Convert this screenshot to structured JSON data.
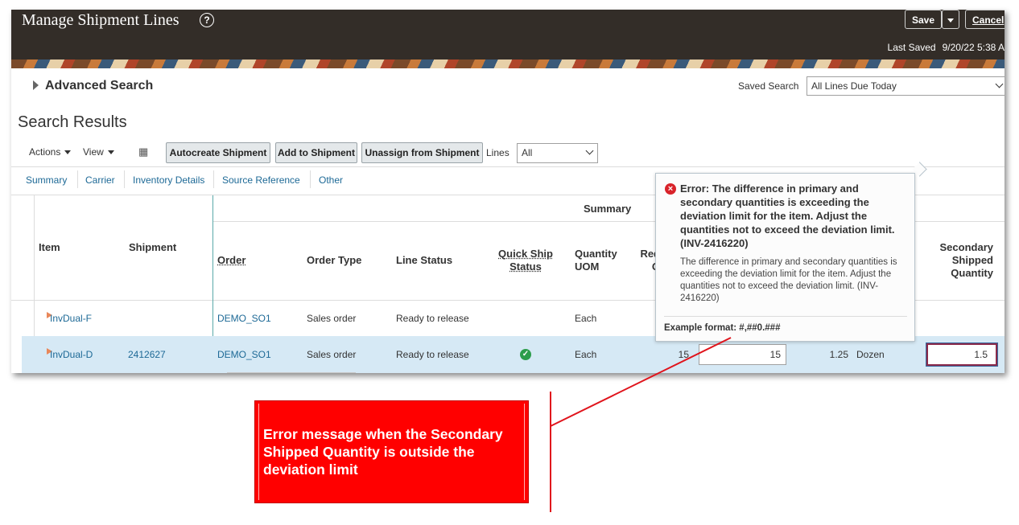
{
  "header": {
    "title": "Manage Shipment Lines",
    "save_label": "Save",
    "cancel_label": "Cancel",
    "last_saved_label": "Last Saved",
    "last_saved_value": "9/20/22 5:38 A"
  },
  "search": {
    "advanced_search_label": "Advanced Search",
    "saved_search_label": "Saved Search",
    "saved_search_value": "All Lines Due Today"
  },
  "results": {
    "title": "Search Results",
    "actions_label": "Actions",
    "view_label": "View",
    "autocreate_label": "Autocreate Shipment",
    "add_label": "Add to Shipment",
    "unassign_label": "Unassign from Shipment",
    "lines_label": "Lines",
    "lines_value": "All"
  },
  "tabs": [
    "Summary",
    "Carrier",
    "Inventory Details",
    "Source Reference",
    "Other"
  ],
  "table": {
    "group_header": "Summary",
    "columns": {
      "item": "Item",
      "shipment": "Shipment",
      "order": "Order",
      "order_type": "Order Type",
      "line_status": "Line Status",
      "quick_ship_1": "Quick Ship",
      "quick_ship_2": "Status",
      "uom_1": "Quantity",
      "uom_2": "UOM",
      "req_1": "Req",
      "req_2": "Q",
      "sec_1": "Secondary",
      "sec_2": "Shipped",
      "sec_3": "Quantity"
    },
    "rows": [
      {
        "item": "InvDual-F",
        "shipment": "",
        "order": "DEMO_SO1",
        "order_type": "Sales order",
        "line_status": "Ready to release",
        "uom": "Each"
      },
      {
        "item": "InvDual-D",
        "shipment": "2412627",
        "order": "DEMO_SO1",
        "order_type": "Sales order",
        "line_status": "Ready to release",
        "uom": "Each",
        "requested": "15",
        "shipped": "15",
        "secondary_requested": "1.25",
        "secondary_uom": "Dozen",
        "secondary_shipped": "1.5"
      }
    ]
  },
  "error": {
    "title": "Error: The difference in primary and secondary quantities is exceeding the deviation limit for the item. Adjust the quantities not to exceed the deviation limit. (INV-2416220)",
    "body": "The difference in primary and secondary quantities is exceeding the deviation limit for the item. Adjust the quantities not to exceed the deviation limit. (INV-2416220)",
    "example": "Example format: #,##0.###"
  },
  "callout": {
    "text": "Error message when the Secondary Shipped Quantity is outside the deviation limit"
  },
  "colors": {
    "header_bg": "#332d28",
    "link": "#1d6996",
    "selected_row": "#d6e9f5",
    "error_red": "#d8232a",
    "callout_red": "#ff0000"
  }
}
